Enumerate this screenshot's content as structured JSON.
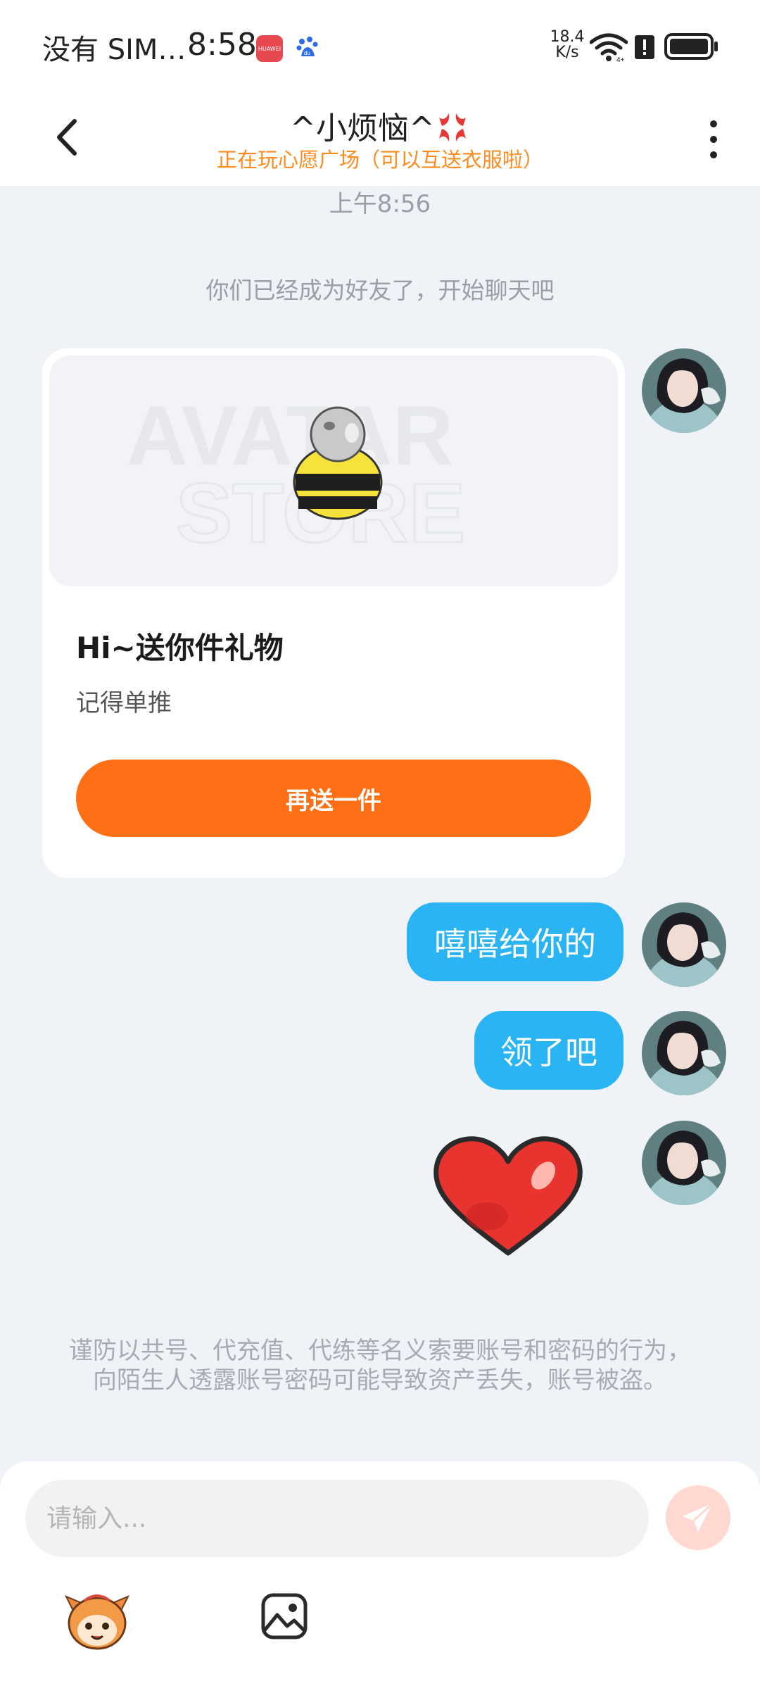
{
  "status_bar": {
    "carrier": "没有 SIM…",
    "time": "8:58",
    "app_badge_text": "HUAWEI",
    "net_speed_value": "18.4",
    "net_speed_unit": "K/s",
    "icons": [
      "huawei-store-icon",
      "baidu-icon",
      "wifi-icon",
      "alert-icon",
      "battery-icon"
    ]
  },
  "header": {
    "title": "^小烦恼^",
    "subtitle": "正在玩心愿广场（可以互送衣服啦）"
  },
  "chat": {
    "timestamp": "上午8:56",
    "system_message": "你们已经成为好友了，开始聊天吧",
    "gift_card": {
      "watermark_line1": "AVATAR",
      "watermark_line2": "STORE",
      "title": "Hi~送你件礼物",
      "description": "记得单推",
      "button_label": "再送一件"
    },
    "messages": [
      {
        "text": "嘻嘻给你的"
      },
      {
        "text": "领了吧"
      }
    ],
    "warning": "谨防以共号、代充值、代练等名义索要账号和密码的行为，向陌生人透露账号密码可能导致资产丢失，账号被盗。"
  },
  "input": {
    "placeholder": "请输入..."
  },
  "colors": {
    "accent_orange": "#ff7016",
    "subtitle_orange": "#ff8a1e",
    "bubble_blue": "#2bb4f4",
    "background": "#eff2f6",
    "send_button": "#ffd8d1"
  }
}
